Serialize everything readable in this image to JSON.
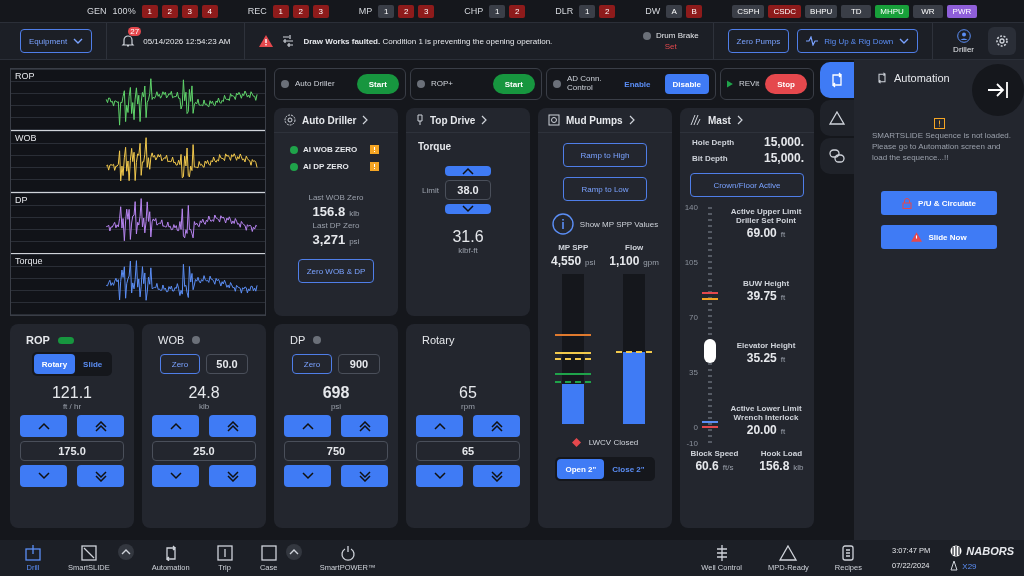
{
  "status_bar": {
    "groups": [
      {
        "label": "GEN",
        "value": "100%",
        "items": [
          {
            "text": "1",
            "color": "#8e1b1b"
          },
          {
            "text": "2",
            "color": "#8e1b1b"
          },
          {
            "text": "3",
            "color": "#8e1b1b"
          },
          {
            "text": "4",
            "color": "#8e1b1b"
          }
        ]
      },
      {
        "label": "REC",
        "items": [
          {
            "text": "1",
            "color": "#8e1b1b"
          },
          {
            "text": "2",
            "color": "#8e1b1b"
          },
          {
            "text": "3",
            "color": "#8e1b1b"
          }
        ]
      },
      {
        "label": "MP",
        "items": [
          {
            "text": "1",
            "color": "#3a3e47"
          },
          {
            "text": "2",
            "color": "#8e1b1b"
          },
          {
            "text": "3",
            "color": "#8e1b1b"
          }
        ]
      },
      {
        "label": "CHP",
        "items": [
          {
            "text": "1",
            "color": "#3a3e47"
          },
          {
            "text": "2",
            "color": "#8e1b1b"
          }
        ]
      },
      {
        "label": "DLR",
        "items": [
          {
            "text": "1",
            "color": "#3a3e47"
          },
          {
            "text": "2",
            "color": "#8e1b1b"
          }
        ]
      },
      {
        "label": "DW",
        "items": [
          {
            "text": "A",
            "color": "#3a3e47"
          },
          {
            "text": "B",
            "color": "#8e1b1b"
          }
        ]
      }
    ],
    "badges": [
      {
        "text": "CSPH",
        "color": "#3a3e47"
      },
      {
        "text": "CSDC",
        "color": "#8e1b1b"
      },
      {
        "text": "BHPU",
        "color": "#3a3e47"
      },
      {
        "text": "TD",
        "color": "#3a3e47"
      },
      {
        "text": "MHPU",
        "color": "#18a03a"
      },
      {
        "text": "WR",
        "color": "#3a3e47"
      },
      {
        "text": "PWR",
        "color": "#8f5fd9"
      }
    ]
  },
  "header": {
    "equipment": "Equipment",
    "notification_count": "27",
    "datetime": "05/14/2026 12:54:23 AM",
    "alert": "**Draw Works faulted.** Condition 1 is preventing the opening operation.",
    "drum_brake": {
      "label": "Drum Brake",
      "status": "Set",
      "on": false
    },
    "zero_pumps": "Zero Pumps",
    "rig_menu": "Rig Up & Rig Down",
    "user": "Driller"
  },
  "chart": {
    "strips": [
      {
        "label": "ROP",
        "color": "#5fd46a"
      },
      {
        "label": "WOB",
        "color": "#f2c94c"
      },
      {
        "label": "DP",
        "color": "#b784f0"
      },
      {
        "label": "Torque",
        "color": "#5b8ef5"
      }
    ]
  },
  "automation_controls": [
    {
      "kind": "start",
      "label": "Auto Driller",
      "active": false,
      "button": "Start"
    },
    {
      "kind": "start",
      "label": "ROP+",
      "active": false,
      "button": "Start"
    },
    {
      "kind": "toggle",
      "label": "AD Conn. Control",
      "active": false,
      "options": [
        {
          "label": "Enable",
          "selected": false
        },
        {
          "label": "Disable",
          "selected": true
        }
      ]
    },
    {
      "kind": "run",
      "label": "REVit",
      "button": "Stop"
    }
  ],
  "auto_driller": {
    "title": "Auto Driller",
    "items": [
      {
        "label": "AI WOB ZERO",
        "on": true,
        "warning": true
      },
      {
        "label": "AI DP ZERO",
        "on": true,
        "warning": true
      }
    ],
    "readings": [
      {
        "label": "Last WOB Zero",
        "value": "156.8",
        "unit": "klb"
      },
      {
        "label": "Last DP Zero",
        "value": "3,271",
        "unit": "psi"
      }
    ],
    "button": "Zero WOB & DP"
  },
  "top_drive": {
    "title": "Top Drive",
    "subtitle": "Torque",
    "limit_label": "Limit",
    "limit": "38.0",
    "value": "31.6",
    "unit": "klbf-ft"
  },
  "mud_pumps": {
    "title": "Mud Pumps",
    "buttons": [
      "Ramp to High",
      "Ramp to Low"
    ],
    "info": "Show MP SPP Values",
    "gauges": [
      {
        "label": "MP SPP",
        "value": "4,550",
        "unit": "psi",
        "level": 0.27
      },
      {
        "label": "Flow",
        "value": "1,100",
        "unit": "gpm",
        "level": 0.48
      }
    ],
    "valve": {
      "label": "LWCV Closed",
      "closed": true
    },
    "choke": [
      {
        "label": "Open 2\"",
        "selected": true
      },
      {
        "label": "Close 2\"",
        "selected": false
      }
    ]
  },
  "mast": {
    "title": "Mast",
    "depths": [
      {
        "label": "Hole Depth",
        "value": "15,000."
      },
      {
        "label": "Bit Depth",
        "value": "15,000."
      }
    ],
    "button": "Crown/Floor Active",
    "scale": [
      "140",
      "105",
      "70",
      "35",
      "0",
      "-10"
    ],
    "level": 0.39,
    "readings": [
      {
        "label": "Active Upper Limit Driller Set Point",
        "value": "69.00",
        "unit": "ft"
      },
      {
        "label": "BUW Height",
        "value": "39.75",
        "unit": "ft"
      },
      {
        "label": "Elevator Height",
        "value": "35.25",
        "unit": "ft"
      },
      {
        "label": "Active Lower Limit Wrench Interlock",
        "value": "20.00",
        "unit": "ft"
      }
    ],
    "stats": [
      {
        "label": "Block Speed",
        "value": "60.6",
        "unit": "ft/s"
      },
      {
        "label": "Hook Load",
        "value": "156.8",
        "unit": "klb"
      }
    ]
  },
  "cards": [
    {
      "kind": "mode",
      "title": "ROP",
      "on": true,
      "highlighted": false,
      "modes": [
        {
          "label": "Rotary",
          "selected": true
        },
        {
          "label": "Slide",
          "selected": false
        }
      ],
      "value": "121.1",
      "unit": "ft / hr",
      "setpoint": "175.0"
    },
    {
      "kind": "zero",
      "title": "WOB",
      "on": false,
      "highlighted": false,
      "zero": "Zero",
      "limit": "50.0",
      "value": "24.8",
      "unit": "klb",
      "setpoint": "25.0"
    },
    {
      "kind": "zero",
      "title": "DP",
      "on": false,
      "highlighted": true,
      "zero": "Zero",
      "limit": "900",
      "value": "698",
      "unit": "psi",
      "setpoint": "750"
    },
    {
      "kind": "plain",
      "title": "Rotary",
      "highlighted": false,
      "value": "65",
      "unit": "rpm",
      "setpoint": "65"
    }
  ],
  "side_rail": [
    {
      "kind": "automation",
      "selected": true
    },
    {
      "kind": "alert",
      "selected": false
    },
    {
      "kind": "link",
      "selected": false
    }
  ],
  "automation_panel": {
    "title": "Automation",
    "message": "SMARTSLIDE Sequence is not loaded. Please go to Automation screen and load the sequence...!!",
    "buttons": [
      {
        "kind": "lock",
        "label": "P/U & Circulate"
      },
      {
        "kind": "warning",
        "label": "Slide Now"
      }
    ]
  },
  "nav": {
    "left": [
      {
        "label": "Drill",
        "kind": "drill",
        "selected": true,
        "expandable": false
      },
      {
        "label": "SmartSLIDE",
        "kind": "slide",
        "selected": false,
        "expandable": true
      },
      {
        "label": "Automation",
        "kind": "automation",
        "selected": false,
        "expandable": false
      },
      {
        "label": "Trip",
        "kind": "trip",
        "selected": false,
        "expandable": false
      },
      {
        "label": "Case",
        "kind": "case",
        "selected": false,
        "expandable": true
      },
      {
        "label": "SmartPOWER™",
        "kind": "power",
        "selected": false,
        "expandable": false
      }
    ],
    "right": [
      {
        "label": "Well Control",
        "kind": "well"
      },
      {
        "label": "MPD-Ready",
        "kind": "mpd"
      },
      {
        "label": "Recipes",
        "kind": "recipes"
      }
    ],
    "time": "3:07:47 PM",
    "date": "07/22/2024",
    "brand": "NABORS",
    "rig": "X29"
  }
}
